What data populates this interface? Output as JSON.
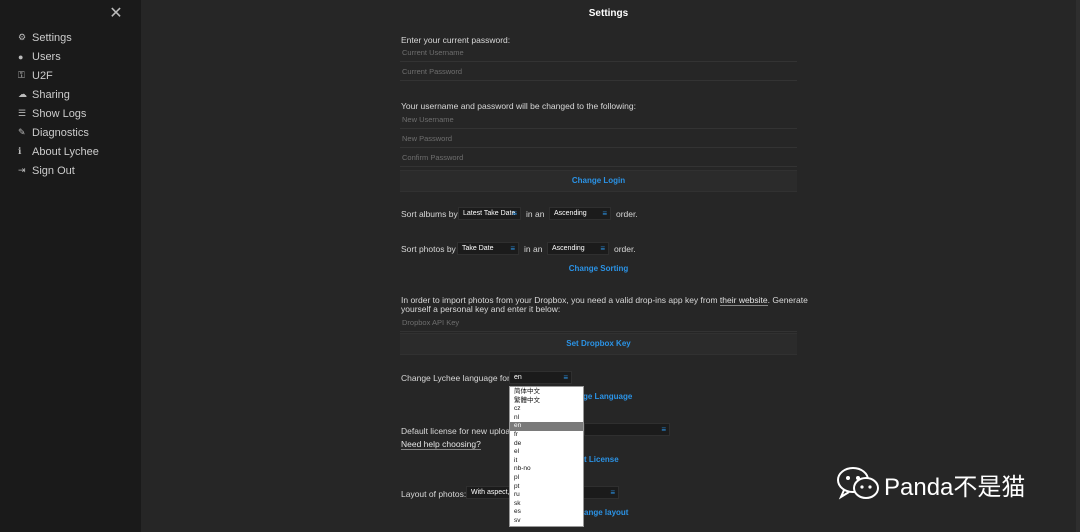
{
  "sidebar": {
    "close_glyph": "✕",
    "items": [
      {
        "label": "Settings",
        "icon": "gear-icon"
      },
      {
        "label": "Users",
        "icon": "user-icon"
      },
      {
        "label": "U2F",
        "icon": "key-icon"
      },
      {
        "label": "Sharing",
        "icon": "cloud-icon"
      },
      {
        "label": "Show Logs",
        "icon": "list-icon"
      },
      {
        "label": "Diagnostics",
        "icon": "wrench-icon"
      },
      {
        "label": "About Lychee",
        "icon": "info-icon"
      },
      {
        "label": "Sign Out",
        "icon": "sign-out-icon"
      }
    ]
  },
  "header": {
    "title": "Settings"
  },
  "login": {
    "intro": "Enter your current password:",
    "current_username_placeholder": "Current Username",
    "current_password_placeholder": "Current Password",
    "change_intro": "Your username and password will be changed to the following:",
    "new_username_placeholder": "New Username",
    "new_password_placeholder": "New Password",
    "confirm_password_placeholder": "Confirm Password",
    "button": "Change Login"
  },
  "sorting": {
    "albums_prefix": "Sort albums by",
    "albums_by": "Latest Take Date",
    "albums_mid": "in an",
    "albums_order": "Ascending",
    "albums_suffix": "order.",
    "photos_prefix": "Sort photos by",
    "photos_by": "Take Date",
    "photos_mid": "in an",
    "photos_order": "Ascending",
    "photos_suffix": "order.",
    "button": "Change Sorting"
  },
  "dropbox": {
    "intro_1": "In order to import photos from your Dropbox, you need a valid drop-ins app key from",
    "link": "their website",
    "intro_2": ". Generate",
    "intro_3": "yourself a personal key and enter it below:",
    "placeholder": "Dropbox API Key",
    "button": "Set Dropbox Key"
  },
  "language": {
    "label": "Change Lychee language for:",
    "value": "en",
    "button": "Change Language",
    "button_visible": "ge Language",
    "options": [
      "简体中文",
      "繁體中文",
      "cz",
      "nl",
      "en",
      "fr",
      "de",
      "el",
      "it",
      "nb-no",
      "pl",
      "pt",
      "ru",
      "sk",
      "es",
      "sv"
    ],
    "selected": "en"
  },
  "license": {
    "label": "Default license for new uploads",
    "help": "Need help choosing?",
    "button_visible": "t License"
  },
  "layout": {
    "label": "Layout of photos:",
    "value": "With aspect,",
    "button_visible": "ange layout"
  },
  "colors": {
    "accent": "#2b93e6",
    "background": "#262626",
    "sidebar": "#1a1a1a"
  },
  "watermark": {
    "text": "Panda不是猫",
    "icon": "wechat-icon"
  }
}
